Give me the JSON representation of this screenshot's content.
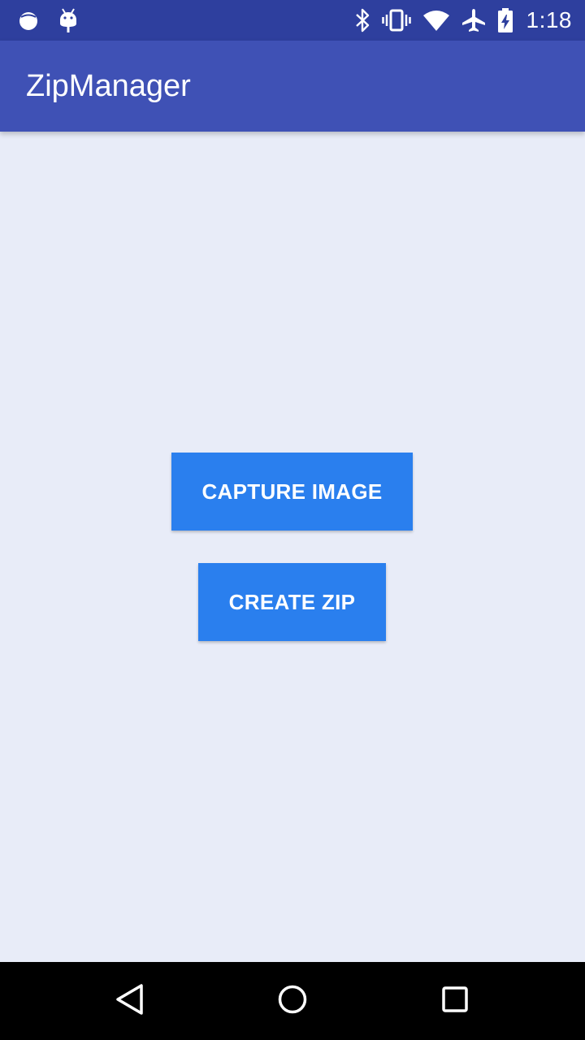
{
  "status_bar": {
    "time": "1:18",
    "left_icons": [
      "notification-dot-icon",
      "android-icon"
    ],
    "right_icons": [
      "bluetooth-icon",
      "vibrate-icon",
      "wifi-icon",
      "airplane-mode-icon",
      "battery-charging-icon"
    ]
  },
  "app_bar": {
    "title": "ZipManager"
  },
  "main": {
    "capture_button_label": "CAPTURE IMAGE",
    "create_zip_button_label": "CREATE ZIP"
  },
  "nav_bar": {
    "icons": [
      "back-icon",
      "home-icon",
      "recents-icon"
    ]
  },
  "colors": {
    "status_bar": "#2e3f9e",
    "app_bar": "#3f51b5",
    "background": "#e8ecf8",
    "button": "#2a7fee",
    "nav_bar": "#000000"
  }
}
